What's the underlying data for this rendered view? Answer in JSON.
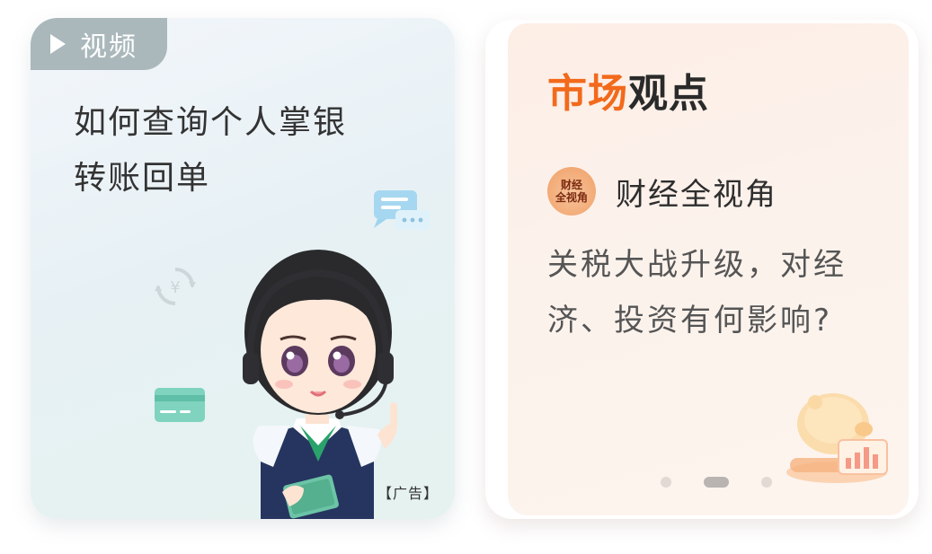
{
  "video_card": {
    "tag_label": "视频",
    "title_line1": "如何查询个人掌银",
    "title_line2": "转账回单",
    "ad_label": "【广告】",
    "colors": {
      "tag_bg": "#aab8bc",
      "title": "#333333"
    }
  },
  "market_card": {
    "title_accent": "市场",
    "title_rest": "观点",
    "column_logo_line1": "财经",
    "column_logo_line2": "全视角",
    "column_name": "财经全视角",
    "headline_line1": "关税大战升级，对经",
    "headline_line2": "济、投资有何影响?",
    "pager": {
      "total": 3,
      "active_index": 1
    },
    "colors": {
      "accent": "#f26a1b",
      "title": "#2a2a2a",
      "headline": "#555555"
    }
  }
}
